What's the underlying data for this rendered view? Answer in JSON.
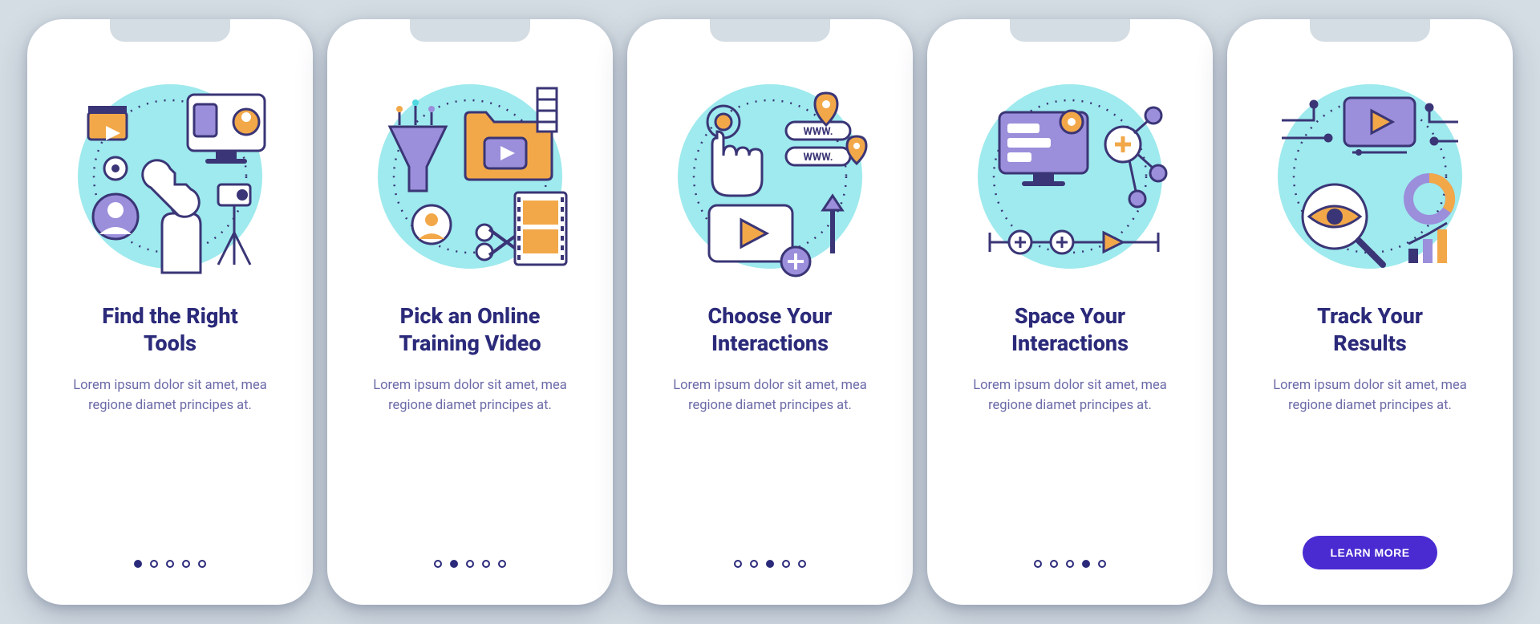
{
  "colors": {
    "bg_page": "#d4dde3",
    "bg_card": "#ffffff",
    "text_heading": "#2b2a7a",
    "text_body": "#6b6aa8",
    "cta_bg": "#4a2bd1",
    "cta_text": "#ffffff",
    "accent_cyan": "#4fd8e0",
    "accent_orange": "#f2a849",
    "accent_purple": "#9b8edb",
    "stroke_dark": "#3a3576"
  },
  "dot_count": 5,
  "screens": [
    {
      "title": "Find the Right\nTools",
      "description": "Lorem ipsum dolor sit amet, mea regione diamet principes at.",
      "active_dot": 0,
      "icon": "tools-video-setup-icon"
    },
    {
      "title": "Pick an Online\nTraining Video",
      "description": "Lorem ipsum dolor sit amet, mea regione diamet principes at.",
      "active_dot": 1,
      "icon": "funnel-video-folder-icon"
    },
    {
      "title": "Choose Your\nInteractions",
      "description": "Lorem ipsum dolor sit amet, mea regione diamet principes at.",
      "active_dot": 2,
      "icon": "touch-links-play-icon"
    },
    {
      "title": "Space Your\nInteractions",
      "description": "Lorem ipsum dolor sit amet, mea regione diamet principes at.",
      "active_dot": 3,
      "icon": "timeline-nodes-icon"
    },
    {
      "title": "Track Your\nResults",
      "description": "Lorem ipsum dolor sit amet, mea regione diamet principes at.",
      "active_dot": 4,
      "icon": "analytics-magnify-icon",
      "cta": "LEARN MORE"
    }
  ]
}
